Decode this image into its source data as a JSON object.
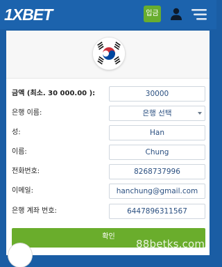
{
  "header": {
    "logo_prefix": "1X",
    "logo_suffix": "BET",
    "deposit_label": "입금",
    "user_icon": "user-icon",
    "menu_icon": "hamburger-menu-icon"
  },
  "colors": {
    "header_bg": "#1c63ad",
    "deposit_green": "#68ad2f",
    "confirm_green": "#6aad2c",
    "field_text": "#2a4f80"
  },
  "form": {
    "flag_icon": "south-korea-flag-icon",
    "amount_label": "금액 (최소.   30 000.00          ):",
    "amount_value": "30000",
    "bank_label": "은행 이름:",
    "bank_value": "은행 선택",
    "surname_label": "성:",
    "surname_value": "Han",
    "name_label": "이름:",
    "name_value": "Chung",
    "phone_label": "전화번호:",
    "phone_value": "8268737996",
    "email_label": "이메일:",
    "email_value": "hanchung@gmail.com",
    "account_label": "은행 계좌 번호:",
    "account_value": "6447896311567",
    "confirm_label": "확인"
  },
  "watermark": "88betks.com"
}
